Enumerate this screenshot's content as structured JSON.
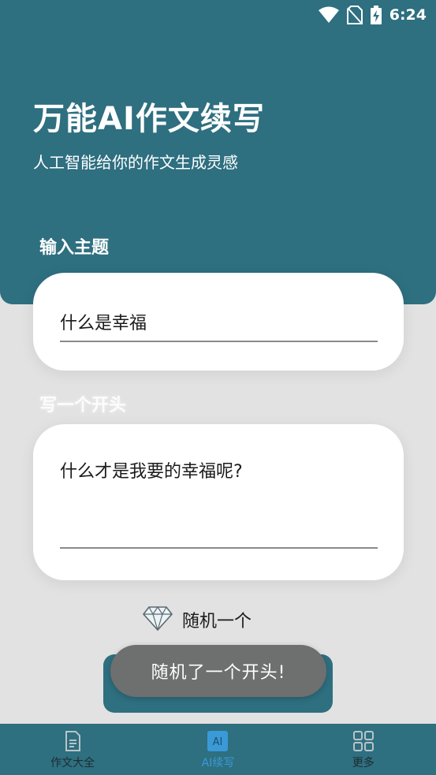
{
  "status_bar": {
    "time": "6:24",
    "icons": [
      "wifi-icon",
      "no-sim-icon",
      "battery-charging-icon"
    ]
  },
  "header": {
    "title": "万能AI作文续写",
    "subtitle": "人工智能给你的作文生成灵感"
  },
  "topic": {
    "label": "输入主题",
    "value": "什么是幸福"
  },
  "opening": {
    "label": "写一个开头",
    "value": "什么才是我要的幸福呢?"
  },
  "random": {
    "icon": "diamond-icon",
    "label": "随机一个"
  },
  "toast": {
    "message": "随机了一个开头!"
  },
  "bottom_nav": {
    "items": [
      {
        "label": "作文大全",
        "icon": "document-icon",
        "active": false
      },
      {
        "label": "AI续写",
        "icon": "ai-icon",
        "active": true
      },
      {
        "label": "更多",
        "icon": "grid-icon",
        "active": false
      }
    ]
  },
  "colors": {
    "primary": "#2e6f80",
    "background": "#e2e2e2",
    "nav_active": "#3a9ad8",
    "toast": "#6e6f6f"
  }
}
